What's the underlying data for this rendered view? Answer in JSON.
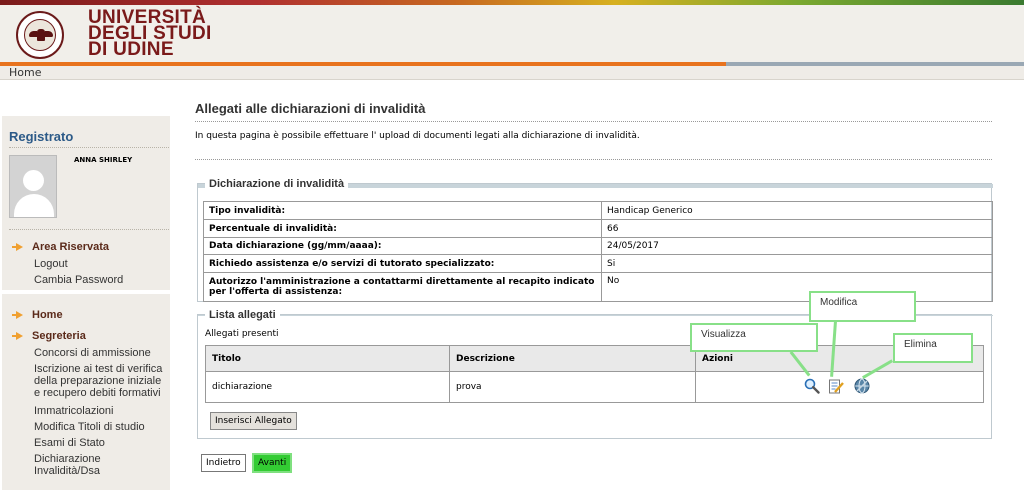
{
  "header": {
    "logo_line1": "UNIVERSITÀ",
    "logo_line2": "DEGLI STUDI",
    "logo_line3": "DI UDINE",
    "logo_icon": "university-seal-icon",
    "colors": {
      "orange": "#e8731e",
      "blue_gray": "#9aa8b4",
      "brand": "#7a1a1a"
    }
  },
  "breadcrumb": {
    "home": "Home"
  },
  "sidebar": {
    "title": "Registrato",
    "user_name": "ANNA SHIRLEY",
    "area_riservata": {
      "heading": "Area Riservata",
      "items": [
        "Logout",
        "Cambia Password"
      ]
    },
    "home": "Home",
    "segreteria": {
      "heading": "Segreteria",
      "items": [
        "Concorsi di ammissione",
        "Iscrizione ai test di verifica della preparazione iniziale e recupero debiti formativi",
        "Immatricolazioni",
        "Modifica Titoli di studio",
        "Esami di Stato",
        "Dichiarazione Invalidità/Dsa"
      ]
    }
  },
  "main": {
    "title": "Allegati alle dichiarazioni di invalidità",
    "intro": "In questa pagina è possibile effettuare l' upload di documenti legati alla dichiarazione di invalidità."
  },
  "dichiarazione": {
    "legend": "Dichiarazione di invalidità",
    "rows": [
      {
        "label": "Tipo invalidità:",
        "value": "Handicap Generico"
      },
      {
        "label": "Percentuale di invalidità:",
        "value": "66"
      },
      {
        "label": "Data dichiarazione (gg/mm/aaaa):",
        "value": "24/05/2017"
      },
      {
        "label": "Richiedo assistenza e/o servizi di tutorato specializzato:",
        "value": "Si"
      },
      {
        "label": "Autorizzo l'amministrazione a contattarmi direttamente al recapito indicato per l'offerta di assistenza:",
        "value": "No"
      }
    ]
  },
  "allegati": {
    "legend": "Lista allegati",
    "subtitle": "Allegati presenti",
    "columns": [
      "Titolo",
      "Descrizione",
      "Azioni"
    ],
    "rows": [
      {
        "titolo": "dichiarazione",
        "descrizione": "prova"
      }
    ],
    "action_icons": [
      "magnifier-icon",
      "edit-icon",
      "delete-icon"
    ],
    "insert_button": "Inserisci Allegato"
  },
  "footer_buttons": {
    "back": "Indietro",
    "next": "Avanti"
  },
  "callouts": {
    "view": "Visualizza",
    "edit": "Modifica",
    "delete": "Elimina"
  }
}
